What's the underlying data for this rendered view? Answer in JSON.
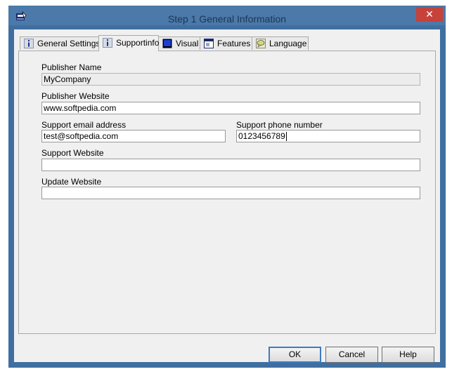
{
  "window": {
    "title": "Step 1 General Information",
    "close_glyph": "✕"
  },
  "tabs": [
    {
      "label": "General Settings",
      "icon": "info-icon",
      "active": false
    },
    {
      "label": "Supportinfo",
      "icon": "info-icon",
      "active": true
    },
    {
      "label": "Visual",
      "icon": "screen-icon",
      "active": false
    },
    {
      "label": "Features",
      "icon": "window-icon",
      "active": false
    },
    {
      "label": "Language",
      "icon": "speech-bubble-icon",
      "active": false
    }
  ],
  "form": {
    "publisher_name": {
      "label": "Publisher Name",
      "value": "MyCompany"
    },
    "publisher_website": {
      "label": "Publisher Website",
      "value": "www.softpedia.com"
    },
    "support_email": {
      "label": "Support email address",
      "value": "test@softpedia.com"
    },
    "support_phone": {
      "label": "Support phone number",
      "value": "0123456789"
    },
    "support_website": {
      "label": "Support Website",
      "value": ""
    },
    "update_website": {
      "label": "Update Website",
      "value": ""
    }
  },
  "buttons": {
    "ok": "OK",
    "cancel": "Cancel",
    "help": "Help"
  },
  "colors": {
    "title_bar": "#4a79aa",
    "close": "#c7423a",
    "client": "#f0f0f0",
    "default_button_border": "#3d7bbd"
  }
}
